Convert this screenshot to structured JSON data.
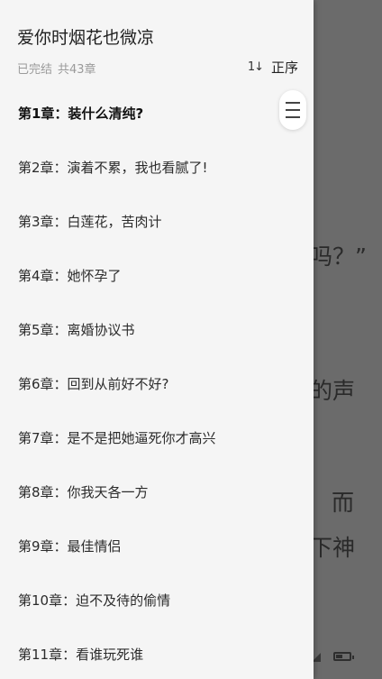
{
  "background": {
    "lines": [
      "吗？”",
      "的声",
      "而",
      "下神"
    ],
    "battery_level": 0.5
  },
  "drawer": {
    "title": "爱你时烟花也微凉",
    "status": "已完结",
    "chapter_count": "共43章",
    "sort_icon": "1↓",
    "sort_label": "正序",
    "chapters": [
      "第1章：装什么清纯?",
      "第2章：演着不累，我也看腻了!",
      "第3章：白莲花，苦肉计",
      "第4章：她怀孕了",
      "第5章：离婚协议书",
      "第6章：回到从前好不好?",
      "第7章：是不是把她逼死你才高兴",
      "第8章：你我天各一方",
      "第9章：最佳情侣",
      "第10章：迫不及待的偷情",
      "第11章：看谁玩死谁"
    ],
    "current_chapter_index": 0
  },
  "icons": {
    "scroll_handle": "menu-lines-icon",
    "battery": "battery-icon",
    "signal": "signal-icon"
  },
  "colors": {
    "drawer_bg": "#f5f5f5",
    "overlay": "#6b6b6b",
    "meta_text": "#9a9a9a"
  }
}
